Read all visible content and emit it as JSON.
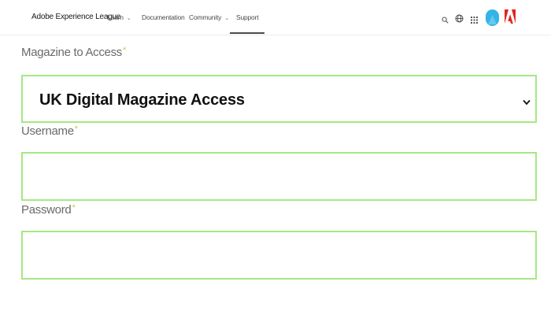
{
  "header": {
    "brand": "Adobe Experience League",
    "nav": [
      {
        "label": "Learn",
        "dropdown": true
      },
      {
        "label": "Documentation",
        "dropdown": false
      },
      {
        "label": "Community",
        "dropdown": true
      },
      {
        "label": "Support",
        "dropdown": false,
        "active": true
      }
    ],
    "icons": [
      "search-icon",
      "globe-icon",
      "apps-grid-icon",
      "avatar",
      "adobe-logo-icon"
    ],
    "avatar_color": "#33b4e6",
    "logo_color": "#e1251b"
  },
  "form": {
    "magazine": {
      "label": "Magazine to Access",
      "required_mark": "*",
      "selected": "UK Digital Magazine Access"
    },
    "username": {
      "label": "Username",
      "required_mark": "*",
      "value": ""
    },
    "password": {
      "label": "Password",
      "required_mark": "*",
      "value": ""
    },
    "field_border_color": "#a5e884"
  }
}
